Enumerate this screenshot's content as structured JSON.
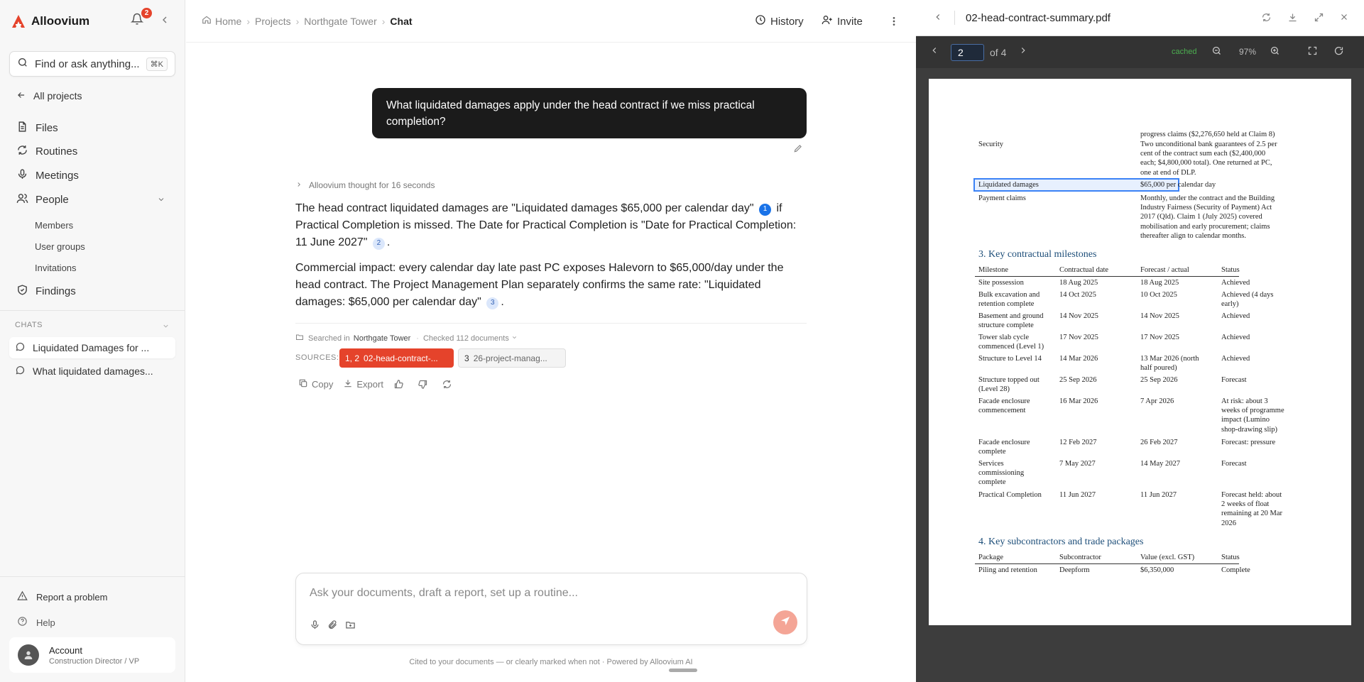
{
  "app": {
    "name": "Alloovium",
    "notifications": "2"
  },
  "search": {
    "placeholder": "Find or ask anything...",
    "shortcut": "⌘K"
  },
  "sidebar": {
    "all_projects": "All projects",
    "items": [
      {
        "label": "Files"
      },
      {
        "label": "Routines"
      },
      {
        "label": "Meetings"
      },
      {
        "label": "People"
      }
    ],
    "people_sub": [
      "Members",
      "User groups",
      "Invitations"
    ],
    "findings": "Findings",
    "chats_label": "CHATS",
    "chats": [
      "Liquidated Damages for ...",
      "What liquidated damages..."
    ],
    "report": "Report a problem",
    "help": "Help",
    "account": {
      "name": "Account",
      "role": "Construction Director / VP"
    }
  },
  "breadcrumb": [
    "Home",
    "Projects",
    "Northgate Tower",
    "Chat"
  ],
  "header": {
    "history": "History",
    "invite": "Invite"
  },
  "conversation": {
    "user_message": "What liquidated damages apply under the head contract if we miss practical completion?",
    "thought": "Alloovium thought for 16 seconds",
    "p1_a": "The head contract liquidated damages are \"Liquidated damages $65,000 per calendar day\"",
    "p1_b": "if Practical Completion is missed. The Date for Practical Completion is \"Date for Practical Completion: 11 June 2027\"",
    "p1_c": ".",
    "p2_a": "Commercial impact: every calendar day late past PC exposes Halevorn to $65,000/day under the head contract. The Project Management Plan separately confirms the same rate: \"Liquidated damages: $65,000 per calendar day\"",
    "p2_b": ".",
    "cite1": "1",
    "cite2": "2",
    "cite3": "3",
    "searched_prefix": "Searched in",
    "searched_project": "Northgate Tower",
    "checked": "Checked 112 documents",
    "sources_label": "SOURCES:",
    "sources": [
      {
        "num": "1, 2",
        "label": "02-head-contract-..."
      },
      {
        "num": "3",
        "label": "26-project-manag..."
      }
    ],
    "actions": {
      "copy": "Copy",
      "export": "Export"
    }
  },
  "composer": {
    "placeholder": "Ask your documents, draft a report, set up a routine..."
  },
  "footnote": "Cited to your documents — or clearly marked when not · Powered by Alloovium AI",
  "viewer": {
    "filename": "02-head-contract-summary.pdf",
    "page": "2",
    "of": "of 4",
    "cached": "cached",
    "zoom": "97%",
    "doc": {
      "top_lines": [
        "progress claims ($2,276,650 held at Claim 8)"
      ],
      "security_label": "Security",
      "security_text": [
        "Two unconditional bank guarantees of 2.5 per",
        "cent of the contract sum each ($2,400,000",
        "each; $4,800,000 total). One returned at PC,",
        "one at end of DLP."
      ],
      "ld_label": "Liquidated damages",
      "ld_value": "$65,000 per calendar day",
      "pay_label": "Payment claims",
      "pay_text": [
        "Monthly, under the contract and the Building",
        "Industry Fairness (Security of Payment) Act",
        "2017 (Qld). Claim 1 (July 2025) covered",
        "mobilisation and early procurement; claims",
        "thereafter align to calendar months."
      ],
      "sec3": "3. Key contractual milestones",
      "m_headers": [
        "Milestone",
        "Contractual date",
        "Forecast / actual",
        "Status"
      ],
      "milestones": [
        {
          "m": [
            "Site possession"
          ],
          "c": "18 Aug 2025",
          "f": [
            "18 Aug 2025"
          ],
          "s": [
            "Achieved"
          ]
        },
        {
          "m": [
            "Bulk excavation and",
            "retention complete"
          ],
          "c": "14 Oct 2025",
          "f": [
            "10 Oct 2025"
          ],
          "s": [
            "Achieved (4 days",
            "early)"
          ]
        },
        {
          "m": [
            "Basement and ground",
            "structure complete"
          ],
          "c": "14 Nov 2025",
          "f": [
            "14 Nov 2025"
          ],
          "s": [
            "Achieved"
          ]
        },
        {
          "m": [
            "Tower slab cycle",
            "commenced (Level 1)"
          ],
          "c": "17 Nov 2025",
          "f": [
            "17 Nov 2025"
          ],
          "s": [
            "Achieved"
          ]
        },
        {
          "m": [
            "Structure to Level 14"
          ],
          "c": "14 Mar 2026",
          "f": [
            "13 Mar 2026 (north",
            "half poured)"
          ],
          "s": [
            "Achieved"
          ]
        },
        {
          "m": [
            "Structure topped out",
            "(Level 28)"
          ],
          "c": "25 Sep 2026",
          "f": [
            "25 Sep 2026"
          ],
          "s": [
            "Forecast"
          ]
        },
        {
          "m": [
            "Facade enclosure",
            "commencement"
          ],
          "c": "16 Mar 2026",
          "f": [
            "7 Apr 2026"
          ],
          "s": [
            "At risk: about 3",
            "weeks of programme",
            "impact (Lumino",
            "shop-drawing slip)"
          ]
        },
        {
          "m": [
            "Facade enclosure",
            "complete"
          ],
          "c": "12 Feb 2027",
          "f": [
            "26 Feb 2027"
          ],
          "s": [
            "Forecast: pressure"
          ]
        },
        {
          "m": [
            "Services",
            "commissioning",
            "complete"
          ],
          "c": "7 May 2027",
          "f": [
            "14 May 2027"
          ],
          "s": [
            "Forecast"
          ]
        },
        {
          "m": [
            "Practical Completion"
          ],
          "c": "11 Jun 2027",
          "f": [
            "11 Jun 2027"
          ],
          "s": [
            "Forecast held: about",
            "2 weeks of float",
            "remaining at 20 Mar",
            "2026"
          ]
        }
      ],
      "sec4": "4. Key subcontractors and trade packages",
      "p_headers": [
        "Package",
        "Subcontractor",
        "Value (excl. GST)",
        "Status"
      ],
      "packages": [
        {
          "p": "Piling and retention",
          "s": "Deepform",
          "v": "$6,350,000",
          "st": "Complete"
        }
      ]
    }
  },
  "colors": {
    "brand": "#e5432b",
    "highlight": "#3b82f6",
    "cite": "#1a73e8"
  }
}
